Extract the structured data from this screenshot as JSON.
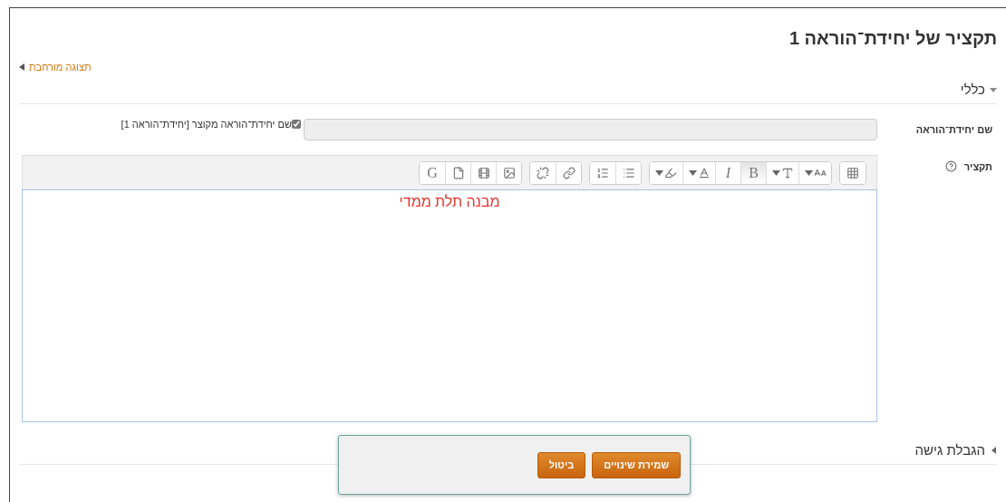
{
  "page_title": "תקציר של יחידת־הוראה 1",
  "expand_link": "תצוגה מורחבת",
  "sections": [
    {
      "title": "כללי",
      "expanded": true
    },
    {
      "title": "הגבלת גישה",
      "expanded": false
    }
  ],
  "name_field": {
    "label": "שם יחידת־הוראה",
    "checkbox": {
      "label": "שם יחידת־הוראה מקוצר [יחידת־הוראה 1]",
      "checked": true
    }
  },
  "summary": {
    "label": "תקציר",
    "content": "מבנה תלת ממדי"
  },
  "toolbar": [
    [
      {
        "kind": "table",
        "selected": false
      }
    ],
    [
      {
        "kind": "size",
        "selected": false
      },
      {
        "kind": "style",
        "selected": false
      },
      {
        "kind": "text",
        "label": "B",
        "selected": true
      },
      {
        "kind": "italic",
        "label": "I",
        "selected": false
      },
      {
        "kind": "color",
        "selected": false
      },
      {
        "kind": "highlight",
        "selected": false
      }
    ],
    [
      {
        "kind": "bullets",
        "selected": false
      },
      {
        "kind": "numbers",
        "selected": false
      }
    ],
    [
      {
        "kind": "link",
        "selected": false
      },
      {
        "kind": "unlink",
        "selected": false
      }
    ],
    [
      {
        "kind": "image",
        "selected": false
      },
      {
        "kind": "media",
        "selected": false
      },
      {
        "kind": "file",
        "selected": false
      },
      {
        "kind": "text",
        "label": "G",
        "selected": false
      }
    ]
  ],
  "buttons": [
    {
      "label": "שמירת שינויים"
    },
    {
      "label": "ביטול"
    }
  ]
}
